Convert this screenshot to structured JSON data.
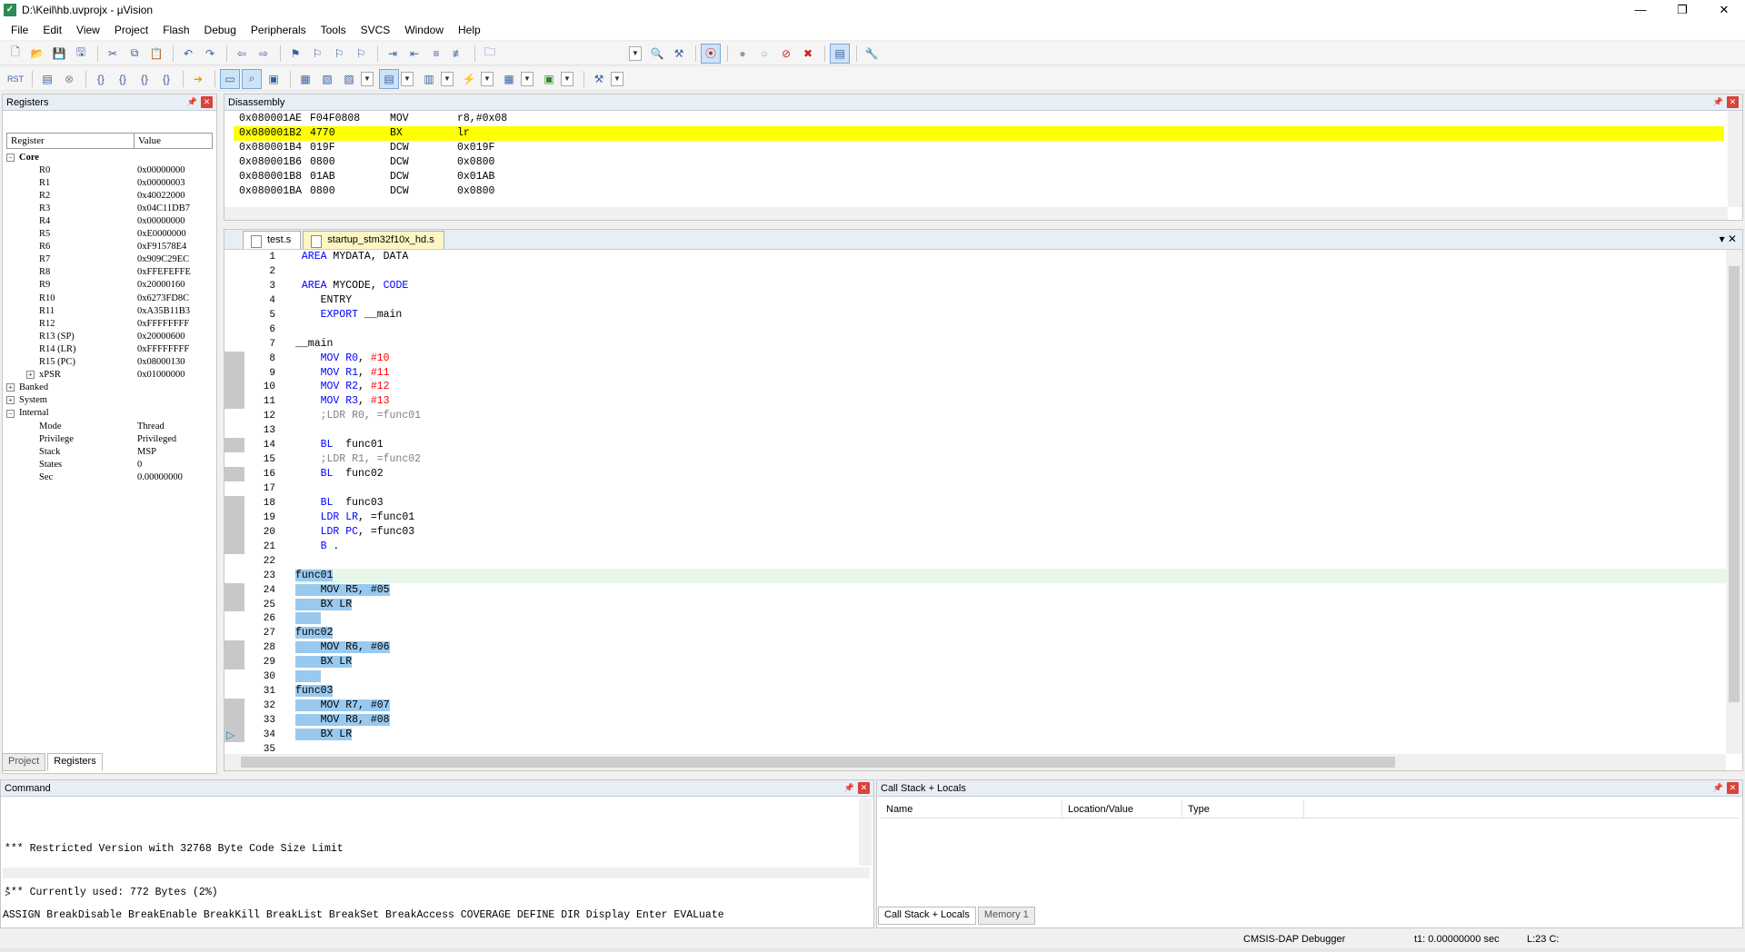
{
  "window": {
    "title": "D:\\Keil\\hb.uvprojx - µVision",
    "app_icon": "uv-icon",
    "controls": [
      "—",
      "❐",
      "✕"
    ]
  },
  "menu": [
    "File",
    "Edit",
    "View",
    "Project",
    "Flash",
    "Debug",
    "Peripherals",
    "Tools",
    "SVCS",
    "Window",
    "Help"
  ],
  "registers": {
    "title": "Registers",
    "col_register": "Register",
    "col_value": "Value",
    "core_label": "Core",
    "core": [
      {
        "name": "R0",
        "value": "0x00000000"
      },
      {
        "name": "R1",
        "value": "0x00000003"
      },
      {
        "name": "R2",
        "value": "0x40022000"
      },
      {
        "name": "R3",
        "value": "0x04C11DB7"
      },
      {
        "name": "R4",
        "value": "0x00000000"
      },
      {
        "name": "R5",
        "value": "0xE0000000"
      },
      {
        "name": "R6",
        "value": "0xF91578E4"
      },
      {
        "name": "R7",
        "value": "0x909C29EC"
      },
      {
        "name": "R8",
        "value": "0xFFEFEFFE"
      },
      {
        "name": "R9",
        "value": "0x20000160"
      },
      {
        "name": "R10",
        "value": "0x6273FD8C"
      },
      {
        "name": "R11",
        "value": "0xA35B11B3"
      },
      {
        "name": "R12",
        "value": "0xFFFFFFFF"
      },
      {
        "name": "R13 (SP)",
        "value": "0x20000600"
      },
      {
        "name": "R14 (LR)",
        "value": "0xFFFFFFFF"
      },
      {
        "name": "R15 (PC)",
        "value": "0x08000130"
      },
      {
        "name": "xPSR",
        "value": "0x01000000"
      }
    ],
    "banked_label": "Banked",
    "system_label": "System",
    "internal_label": "Internal",
    "internal": [
      {
        "name": "Mode",
        "value": "Thread"
      },
      {
        "name": "Privilege",
        "value": "Privileged"
      },
      {
        "name": "Stack",
        "value": "MSP"
      },
      {
        "name": "States",
        "value": "0"
      },
      {
        "name": "Sec",
        "value": "0.00000000"
      }
    ],
    "tabs": [
      "Project",
      "Registers"
    ]
  },
  "disassembly": {
    "title": "Disassembly",
    "lines": [
      {
        "addr": "0x080001AE",
        "opcode": "F04F0808",
        "mnemonic": "MOV",
        "operands": "r8,#0x08"
      },
      {
        "addr": "0x080001B2",
        "opcode": "4770",
        "mnemonic": "BX",
        "operands": "lr"
      },
      {
        "addr": "0x080001B4",
        "opcode": "019F",
        "mnemonic": "DCW",
        "operands": "0x019F"
      },
      {
        "addr": "0x080001B6",
        "opcode": "0800",
        "mnemonic": "DCW",
        "operands": "0x0800"
      },
      {
        "addr": "0x080001B8",
        "opcode": "01AB",
        "mnemonic": "DCW",
        "operands": "0x01AB"
      },
      {
        "addr": "0x080001BA",
        "opcode": "0800",
        "mnemonic": "DCW",
        "operands": "0x0800"
      }
    ]
  },
  "editor": {
    "tabs": [
      "test.s",
      "startup_stm32f10x_hd.s"
    ]
  },
  "command": {
    "title": "Command",
    "output": [
      "*** Restricted Version with 32768 Byte Code Size Limit",
      "*** Currently used: 772 Bytes (2%)"
    ],
    "prompt": ">",
    "hints": "ASSIGN BreakDisable BreakEnable BreakKill BreakList BreakSet BreakAccess COVERAGE DEFINE DIR Display Enter EVALuate"
  },
  "callstack": {
    "title": "Call Stack + Locals",
    "columns": [
      "Name",
      "Location/Value",
      "Type"
    ],
    "tabs": [
      "Call Stack + Locals",
      "Memory 1"
    ]
  },
  "status": {
    "debugger": "CMSIS-DAP Debugger",
    "time": "t1: 0.00000000 sec",
    "cursor": "L:23 C:"
  }
}
